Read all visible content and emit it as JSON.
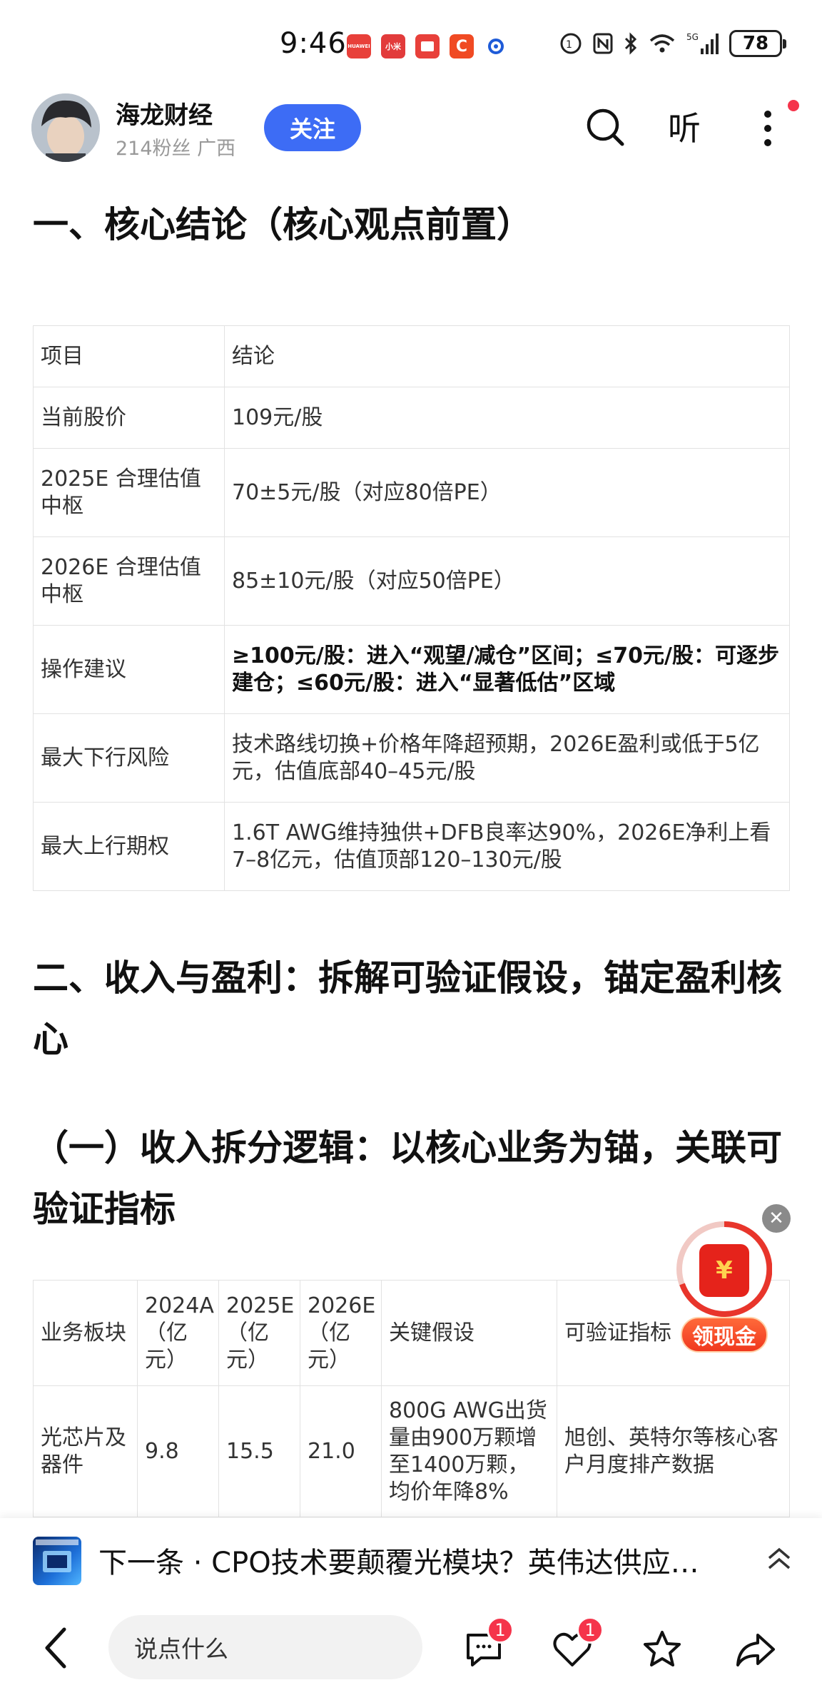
{
  "status_bar": {
    "time": "9:46",
    "battery": "78",
    "notifications": [
      {
        "name": "huawei-notif-icon",
        "text": "HUAWEI",
        "color": "#e8403a"
      },
      {
        "name": "mi-store-notif-icon",
        "text": "小米",
        "color": "#e23b3b"
      },
      {
        "name": "book-notif-icon",
        "text": "",
        "color": "#e8403a"
      },
      {
        "name": "c-app-notif-icon",
        "text": "C",
        "color": "#f04a23"
      },
      {
        "name": "browser-notif-icon",
        "text": "",
        "color": "#1e5bd8"
      }
    ]
  },
  "header": {
    "author_name": "海龙财经",
    "author_meta": "214粉丝 广西",
    "follow_label": "关注",
    "listen_label": "听"
  },
  "article": {
    "section1_title": "一、核心结论（核心观点前置）",
    "table1": {
      "rows": [
        [
          "项目",
          "结论"
        ],
        [
          "当前股价",
          "109元/股"
        ],
        [
          "2025E 合理估值中枢",
          "70±5元/股（对应80倍PE）"
        ],
        [
          "2026E 合理估值中枢",
          "85±10元/股（对应50倍PE）"
        ],
        [
          "操作建议",
          "≥100元/股：进入“观望/减仓”区间；≤70元/股：可逐步建仓；≤60元/股：进入“显著低估”区域"
        ],
        [
          "最大下行风险",
          "技术路线切换+价格年降超预期，2026E盈利或低于5亿元，估值底部40–45元/股"
        ],
        [
          "最大上行期权",
          "1.6T AWG维持独供+DFB良率达90%，2026E净利上看7–8亿元，估值顶部120–130元/股"
        ]
      ]
    },
    "section2_title": "二、收入与盈利：拆解可验证假设，锚定盈利核心",
    "section2_sub": "（一）收入拆分逻辑：以核心业务为锚，关联可验证指标",
    "table2": {
      "headers": [
        "业务板块",
        "2024A（亿元）",
        "2025E（亿元）",
        "2026E（亿元）",
        "关键假设",
        "可验证指标"
      ],
      "rows": [
        [
          "光芯片及器件",
          "9.8",
          "15.5",
          "21.0",
          "800G AWG出货量由900万颗增至1400万颗，均价年降8%",
          "旭创、英特尔等核心客户月度排产数据"
        ]
      ]
    }
  },
  "red_packet": {
    "icon_text": "¥",
    "label": "领现金"
  },
  "next_article": {
    "text": "下一条 · CPO技术要颠覆光模块？英伟达供应…"
  },
  "bottom_bar": {
    "comment_placeholder": "说点什么",
    "comment_count": "1",
    "like_count": "1"
  },
  "colors": {
    "accent": "#3d6cf5",
    "badge": "#f5344b",
    "red_packet": "#e5231b"
  }
}
